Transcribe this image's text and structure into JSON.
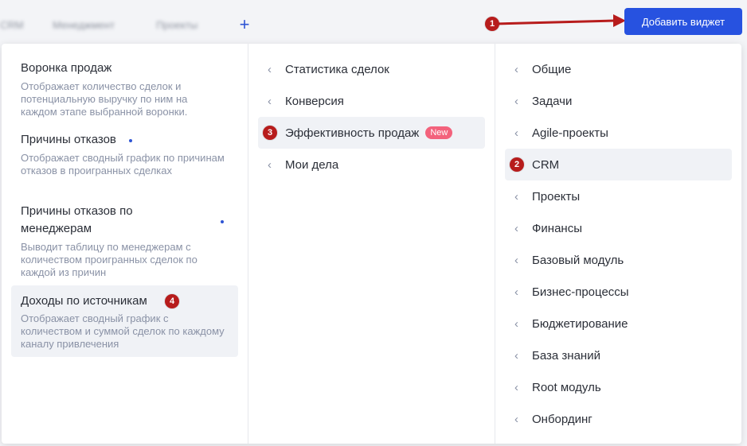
{
  "header": {
    "tabs": [
      "CRM",
      "Менеджмент",
      "Проекты"
    ],
    "plus_icon": "+",
    "add_widget_label": "Добавить виджет"
  },
  "markers": {
    "m1": "1",
    "m2": "2",
    "m3": "3",
    "m4": "4"
  },
  "widgets": [
    {
      "title": "Воронка продаж",
      "description": "Отображает количество сделок и потенциальную выручку по ним на каждом этапе выбранной воронки."
    },
    {
      "title": "Причины отказов",
      "description": "Отображает сводный график по причинам отказов в проигранных сделках"
    },
    {
      "title": "Причины отказов по менеджерам",
      "description": "Выводит таблицу по менеджерам с количеством проигранных сделок по каждой из причин"
    },
    {
      "title": "Доходы по источникам",
      "description": "Отображает сводный график с количеством и суммой сделок по каждому каналу привлечения"
    }
  ],
  "subcategories": [
    {
      "label": "Статистика сделок"
    },
    {
      "label": "Конверсия"
    },
    {
      "label": "Эффективность продаж",
      "badge": "New"
    },
    {
      "label": "Мои дела"
    }
  ],
  "categories": [
    "Общие",
    "Задачи",
    "Agile-проекты",
    "CRM",
    "Проекты",
    "Финансы",
    "Базовый модуль",
    "Бизнес-процессы",
    "Бюджетирование",
    "База знаний",
    "Root модуль",
    "Онбординг"
  ],
  "colors": {
    "accent": "#2752e0",
    "marker": "#b71c1c",
    "new_badge": "#f3627c",
    "active_row": "#f0f2f6"
  }
}
